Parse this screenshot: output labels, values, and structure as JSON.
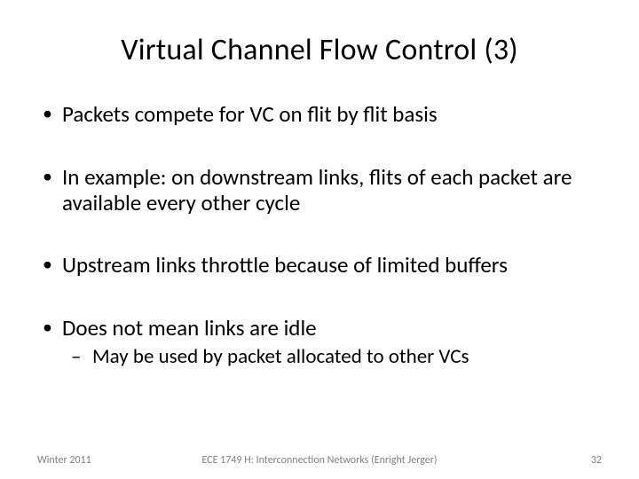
{
  "title": "Virtual Channel Flow Control (3)",
  "bullets": [
    {
      "text": "Packets compete for VC on flit by flit basis"
    },
    {
      "text": "In example: on downstream links, flits of each packet are available every other cycle"
    },
    {
      "text": "Upstream links throttle because of limited buffers"
    },
    {
      "text": "Does not mean links are idle",
      "sub": [
        "May be used by packet allocated to other VCs"
      ]
    }
  ],
  "footer": {
    "left": "Winter 2011",
    "center": "ECE 1749 H: Interconnection Networks (Enright Jerger)",
    "right": "32"
  }
}
